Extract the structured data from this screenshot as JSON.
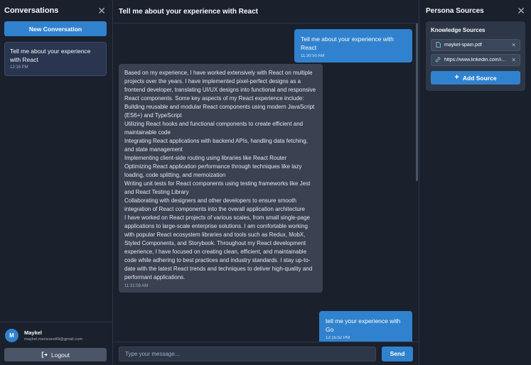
{
  "left_sidebar": {
    "title": "Conversations",
    "new_button": "New Conversation",
    "conversations": [
      {
        "title": "Tell me about your experience with React",
        "time": "12:16 PM"
      }
    ],
    "user": {
      "initial": "M",
      "name": "Maykel",
      "email": "maykel.meneses89@gmail.com"
    },
    "logout_label": "Logout"
  },
  "chat": {
    "title": "Tell me about your experience with React",
    "messages": [
      {
        "role": "user",
        "text": "Tell me about your experience with React",
        "time": "11:30:50 AM"
      },
      {
        "role": "assistant",
        "text": "Based on my experience, I have worked extensively with React on multiple projects over the years. I have implemented pixel-perfect designs as a frontend developer, translating UI/UX designs into functional and responsive React components. Some key aspects of my React experience include:\nBuilding reusable and modular React components using modern JavaScript (ES6+) and TypeScript\nUtilizing React hooks and functional components to create efficient and maintainable code\nIntegrating React applications with backend APIs, handling data fetching, and state management\nImplementing client-side routing using libraries like React Router\nOptimizing React application performance through techniques like lazy loading, code splitting, and memoization\nWriting unit tests for React components using testing frameworks like Jest and React Testing Library\nCollaborating with designers and other developers to ensure smooth integration of React components into the overall application architecture\nI have worked on React projects of various scales, from small single-page applications to large-scale enterprise solutions. I am comfortable working with popular React ecosystem libraries and tools such as Redux, MobX, Styled Components, and Storybook. Throughout my React development experience, I have focused on creating clean, efficient, and maintainable code while adhering to best practices and industry standards. I stay up-to-date with the latest React trends and techniques to deliver high-quality and performant applications.",
        "time": "11:31:08 AM"
      },
      {
        "role": "user",
        "text": "tell me your experience with Go",
        "time": "12:15:52 PM"
      }
    ],
    "input_placeholder": "Type your message...",
    "send_label": "Send"
  },
  "right_sidebar": {
    "title": "Persona Sources",
    "section_title": "Knowledge Sources",
    "sources": [
      {
        "icon": "document-icon",
        "label": "maykel-spain.pdf"
      },
      {
        "icon": "link-icon",
        "label": "https://www.linkedin.com/in..."
      }
    ],
    "add_label": "Add Source"
  },
  "colors": {
    "accent": "#3182ce",
    "background": "#1a202c",
    "panel": "#2d3748",
    "assistant_bubble": "#3a4150"
  }
}
